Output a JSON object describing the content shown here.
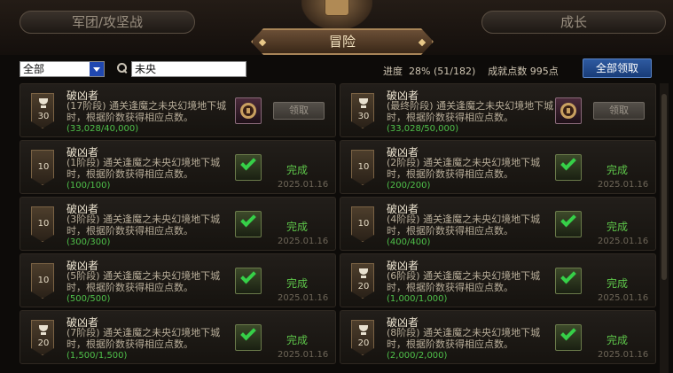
{
  "tabs": {
    "left": "军团/攻坚战",
    "center": "冒险",
    "right": "成长"
  },
  "toolbar": {
    "category": "全部",
    "search_value": "未央",
    "progress_label": "进度",
    "progress_pct": "28%",
    "progress_count": "(51/182)",
    "points_label": "成就点数",
    "points_value": "995点",
    "claim_all": "全部领取"
  },
  "cards": [
    {
      "badge_type": "trophy",
      "badge": "30",
      "title": "破凶者",
      "desc": "(17阶段) 通关逢魔之未央幻境地下城时，根据阶数获得相应点数。",
      "progress": "(33,028/40,000)",
      "state": "claim",
      "button": "领取"
    },
    {
      "badge_type": "trophy",
      "badge": "30",
      "title": "破凶者",
      "desc": "(最终阶段) 通关逢魔之未央幻境地下城时，根据阶数获得相应点数。",
      "progress": "(33,028/50,000)",
      "state": "claim",
      "button": "领取"
    },
    {
      "badge_type": "plain",
      "badge": "10",
      "title": "破凶者",
      "desc": "(1阶段) 通关逢魔之未央幻境地下城时，根据阶数获得相应点数。",
      "progress": "(100/100)",
      "state": "done",
      "status": "完成",
      "date": "2025.01.16"
    },
    {
      "badge_type": "plain",
      "badge": "10",
      "title": "破凶者",
      "desc": "(2阶段) 通关逢魔之未央幻境地下城时，根据阶数获得相应点数。",
      "progress": "(200/200)",
      "state": "done",
      "status": "完成",
      "date": "2025.01.16"
    },
    {
      "badge_type": "plain",
      "badge": "10",
      "title": "破凶者",
      "desc": "(3阶段) 通关逢魔之未央幻境地下城时，根据阶数获得相应点数。",
      "progress": "(300/300)",
      "state": "done",
      "status": "完成",
      "date": "2025.01.16"
    },
    {
      "badge_type": "plain",
      "badge": "10",
      "title": "破凶者",
      "desc": "(4阶段) 通关逢魔之未央幻境地下城时，根据阶数获得相应点数。",
      "progress": "(400/400)",
      "state": "done",
      "status": "完成",
      "date": "2025.01.16"
    },
    {
      "badge_type": "plain",
      "badge": "10",
      "title": "破凶者",
      "desc": "(5阶段) 通关逢魔之未央幻境地下城时，根据阶数获得相应点数。",
      "progress": "(500/500)",
      "state": "done",
      "status": "完成",
      "date": "2025.01.16"
    },
    {
      "badge_type": "trophy",
      "badge": "20",
      "title": "破凶者",
      "desc": "(6阶段) 通关逢魔之未央幻境地下城时，根据阶数获得相应点数。",
      "progress": "(1,000/1,000)",
      "state": "done",
      "status": "完成",
      "date": "2025.01.16"
    },
    {
      "badge_type": "trophy",
      "badge": "20",
      "title": "破凶者",
      "desc": "(7阶段) 通关逢魔之未央幻境地下城时，根据阶数获得相应点数。",
      "progress": "(1,500/1,500)",
      "state": "done",
      "status": "完成",
      "date": "2025.01.16"
    },
    {
      "badge_type": "trophy",
      "badge": "20",
      "title": "破凶者",
      "desc": "(8阶段) 通关逢魔之未央幻境地下城时，根据阶数获得相应点数。",
      "progress": "(2,000/2,000)",
      "state": "done",
      "status": "完成",
      "date": "2025.01.16"
    }
  ]
}
